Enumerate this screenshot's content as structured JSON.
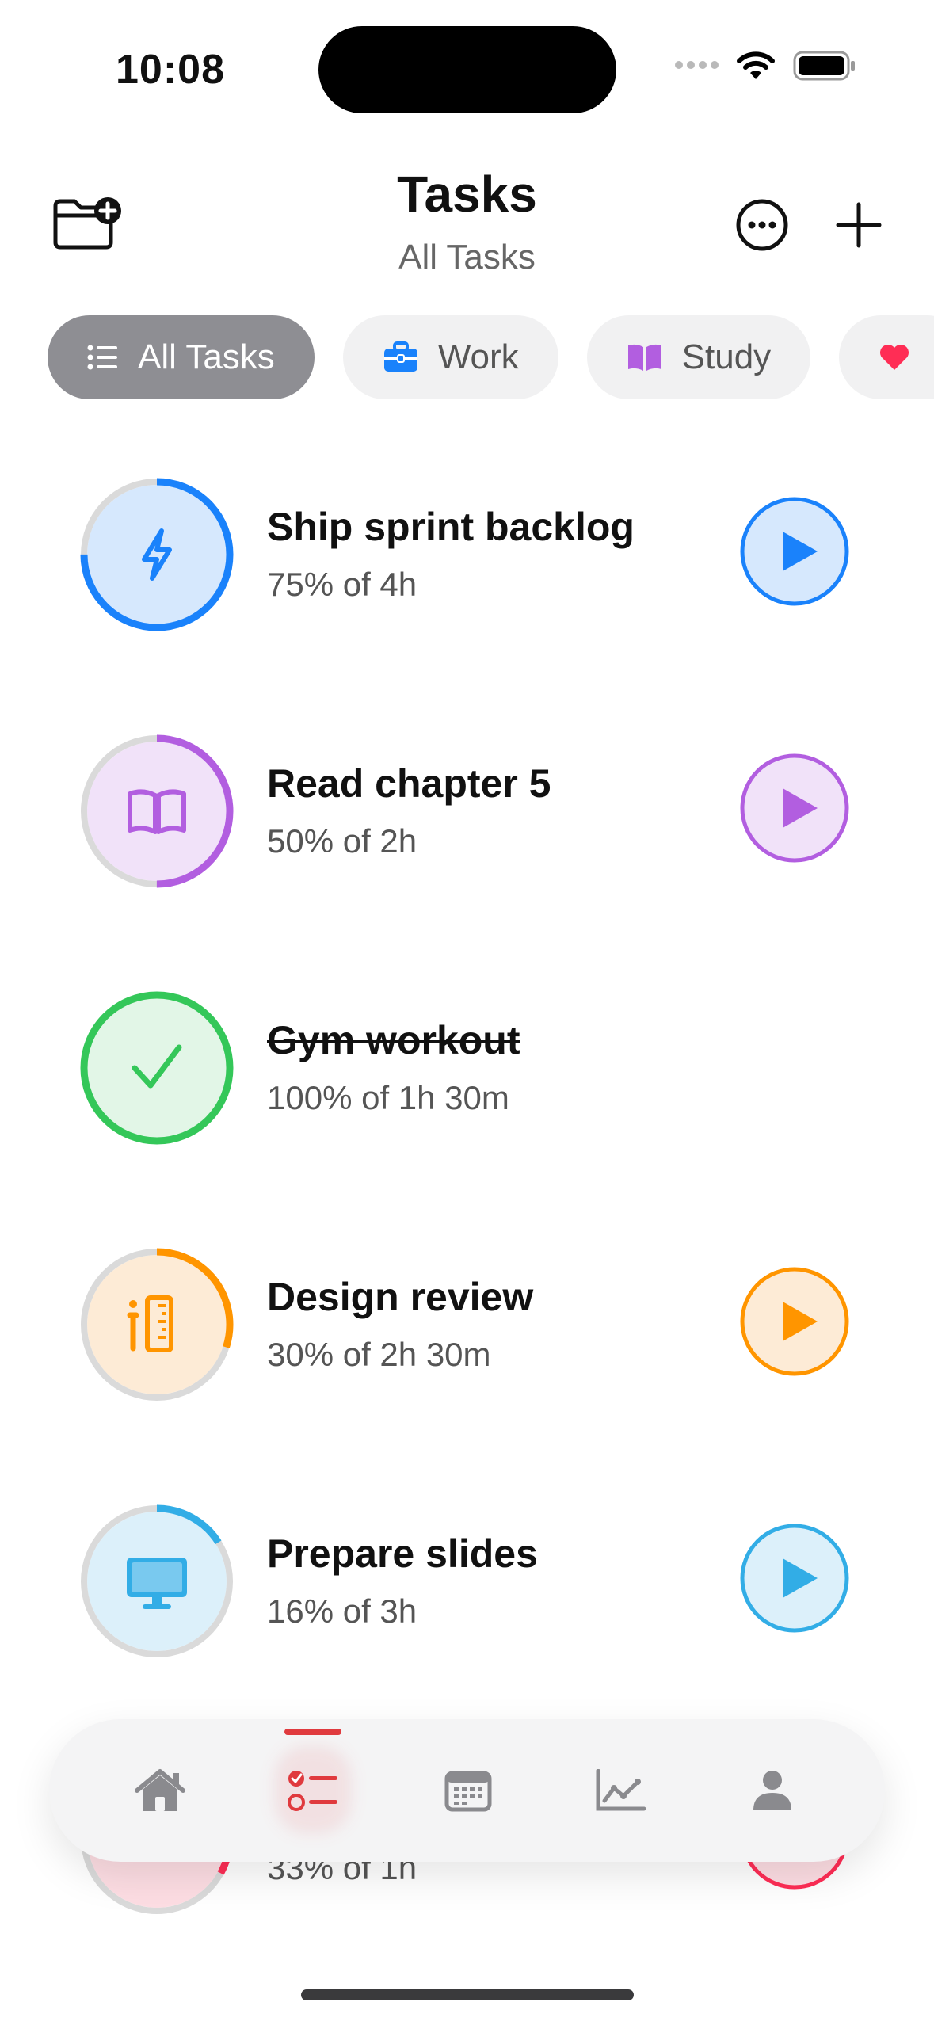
{
  "status": {
    "time": "10:08"
  },
  "header": {
    "title": "Tasks",
    "subtitle": "All Tasks",
    "new_folder_icon": "folder-plus-icon",
    "more_icon": "ellipsis-circle-icon",
    "add_icon": "plus-icon"
  },
  "categories": [
    {
      "label": "All Tasks",
      "icon": "list-icon",
      "active": true
    },
    {
      "label": "Work",
      "icon": "briefcase-icon",
      "color": "#1a82fb"
    },
    {
      "label": "Study",
      "icon": "book-icon",
      "color": "#b25ee0"
    },
    {
      "label": "",
      "icon": "heart-icon",
      "color": "#ff2d55"
    }
  ],
  "tasks": [
    {
      "name": "Ship sprint backlog",
      "progress_text": "75% of 4h",
      "progress": 0.75,
      "color": "#1a82fb",
      "tint": "#d6e8fd",
      "icon": "bolt-icon",
      "completed": false
    },
    {
      "name": "Read chapter 5",
      "progress_text": "50% of 2h",
      "progress": 0.5,
      "color": "#b25ee0",
      "tint": "#f1e2f9",
      "icon": "book-icon",
      "completed": false
    },
    {
      "name": "Gym workout",
      "progress_text": "100% of 1h 30m",
      "progress": 1.0,
      "color": "#34c759",
      "tint": "#e2f6e7",
      "icon": "checkmark-icon",
      "completed": true
    },
    {
      "name": "Design review",
      "progress_text": "30% of 2h 30m",
      "progress": 0.3,
      "color": "#ff9500",
      "tint": "#fdebd6",
      "icon": "pencil-ruler-icon",
      "completed": false
    },
    {
      "name": "Prepare slides",
      "progress_text": "16% of 3h",
      "progress": 0.16,
      "color": "#32ade6",
      "tint": "#dcf0fa",
      "icon": "desktop-icon",
      "completed": false
    },
    {
      "name": "",
      "progress_text": "33% of 1h",
      "progress": 0.33,
      "color": "#ff2d55",
      "tint": "#fddde3",
      "icon": "heart-icon",
      "completed": false
    }
  ],
  "tabbar": {
    "tabs": [
      "home-icon",
      "task-list-icon",
      "calendar-icon",
      "chart-icon",
      "person-icon"
    ],
    "active_index": 1,
    "active_color": "#e03a3e"
  }
}
